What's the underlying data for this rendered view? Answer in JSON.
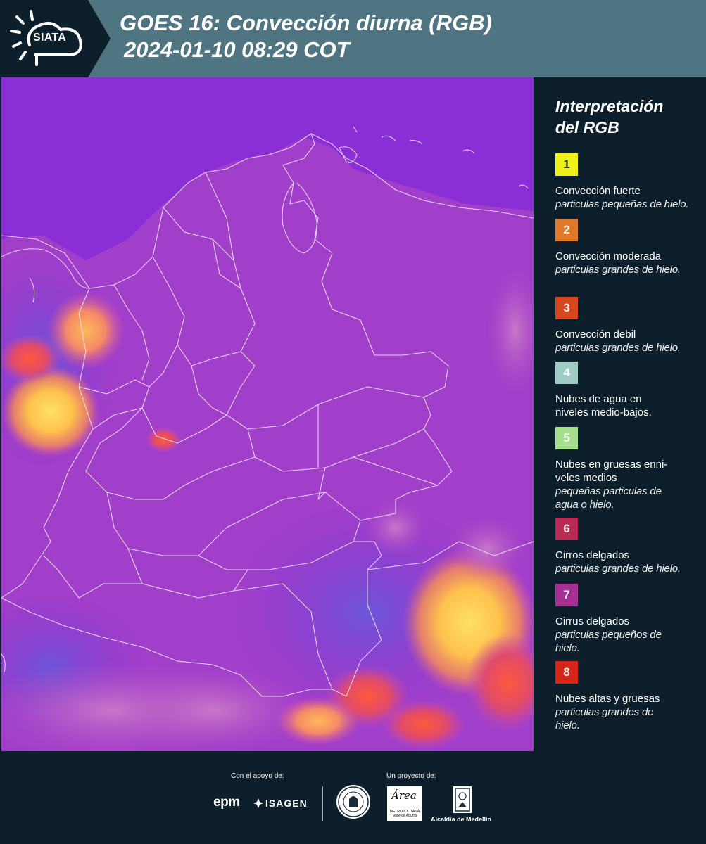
{
  "header": {
    "brand": "SIATA",
    "title_line1": "GOES 16: Convección diurna (RGB)",
    "title_line2": "2024-01-10 08:29 COT",
    "colors": {
      "bar": "#4f7482",
      "dark": "#0c1f2b"
    }
  },
  "legend": {
    "title_line1": "Interpretación",
    "title_line2": "del RGB",
    "items": [
      {
        "number": "1",
        "color": "#eef21a",
        "label": "Convección fuerte",
        "sub": "particulas pequeñas de hielo."
      },
      {
        "number": "2",
        "color": "#e0782a",
        "label": "Convección moderada",
        "sub": "particulas grandes de hielo."
      },
      {
        "number": "3",
        "color": "#d8461f",
        "label": "Convección debil",
        "sub": "particulas grandes de hielo."
      },
      {
        "number": "4",
        "color": "#9fcdc6",
        "label": "Nubes de agua en niveles medio-bajos.",
        "sub": ""
      },
      {
        "number": "5",
        "color": "#a6e08c",
        "label": "Nubes en gruesas enni-veles medios",
        "sub": "pequeñas particulas de agua o hielo."
      },
      {
        "number": "6",
        "color": "#bb2a52",
        "label": "Cirros delgados",
        "sub": "particulas grandes de hielo."
      },
      {
        "number": "7",
        "color": "#a52f92",
        "label": "Cirrus delgados",
        "sub": "particulas pequeños de hielo."
      },
      {
        "number": "8",
        "color": "#d62418",
        "label": "Nubes altas y gruesas",
        "sub": "particulas grandes de hielo."
      }
    ]
  },
  "footer": {
    "support_label": "Con el apoyo de:",
    "project_label": "Un proyecto de:",
    "epm": "epm",
    "isagen": "ISAGEN",
    "area": "Área",
    "area_sub": "METROPOLITANA Valle de Aburrá",
    "alcaldia": "Alcaldía de Medellín"
  }
}
